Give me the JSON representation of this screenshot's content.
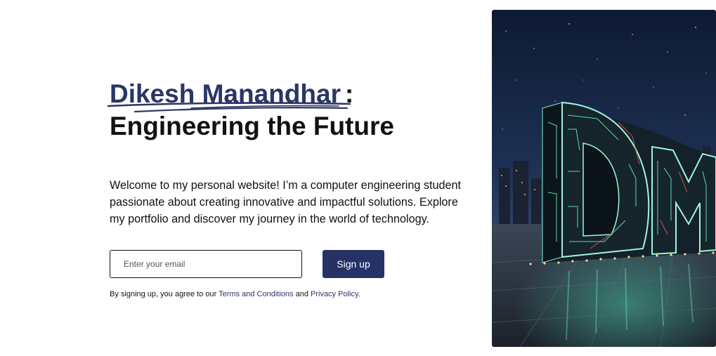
{
  "hero": {
    "name": "Dikesh Manandhar",
    "colon": ":",
    "tagline": "Engineering the Future",
    "intro": "Welcome to my personal website! I’m a computer engineering student passionate about creating innovative and impactful solutions. Explore my portfolio and discover my journey in the world of technology."
  },
  "signup_form": {
    "email_placeholder": "Enter your email",
    "button_label": "Sign up",
    "terms_prefix": "By signing up, you agree to our",
    "terms_link": "Terms and Conditions",
    "and_text": "and",
    "privacy_link": "Privacy Policy",
    "period": "."
  },
  "image": {
    "sign_letters": "DM"
  },
  "colors": {
    "accent": "#263266",
    "name_color": "#2b3566",
    "text": "#111111",
    "background": "#ffffff"
  }
}
